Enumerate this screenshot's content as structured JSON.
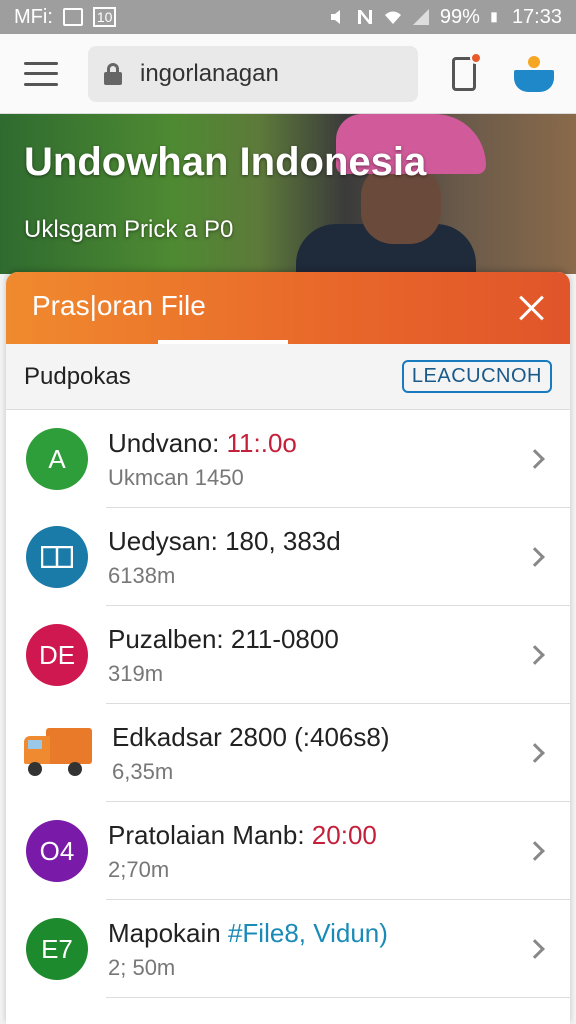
{
  "status_bar": {
    "carrier": "MFi:",
    "badge": "10",
    "battery": "99%",
    "time": "17:33"
  },
  "browser": {
    "url": "ingorlanagan"
  },
  "hero": {
    "title": "Undowhan Indonesia",
    "subtitle": "Uklsgam Prick a P0"
  },
  "sheet": {
    "title": "Pras|oran File",
    "section_title": "Pudpokas",
    "section_action": "LEACUCNOH",
    "items": [
      {
        "avatar": "A",
        "avatar_color": "#2e9e3a",
        "title": "Undvano: ",
        "title_hl": "11:.0o",
        "hl": "red",
        "subtitle": "Ukmcan 1450"
      },
      {
        "avatar": "",
        "avatar_color": "#1a7aa8",
        "avatar_icon": "window-icon",
        "title": "Uedysan: 180, 383d",
        "title_hl": "",
        "hl": "",
        "subtitle": "6138m"
      },
      {
        "avatar": "DE",
        "avatar_color": "#d01850",
        "title": "Puzalben: 211-0800",
        "title_hl": "",
        "hl": "",
        "subtitle": "319m"
      },
      {
        "avatar": "",
        "avatar_color": "",
        "avatar_icon": "truck-icon",
        "title": "Edkadsar 2800 (:406s8)",
        "title_hl": "",
        "hl": "",
        "subtitle": "6,35m"
      },
      {
        "avatar": "O4",
        "avatar_color": "#7a1aa8",
        "title": "Pratolaian Manb: ",
        "title_hl": "20:00",
        "hl": "red",
        "subtitle": "2;70m"
      },
      {
        "avatar": "E7",
        "avatar_color": "#1e8a2e",
        "title": "Mapokain ",
        "title_hl": "#File8, Vidun)",
        "hl": "blue",
        "subtitle": "2; 50m"
      }
    ]
  }
}
